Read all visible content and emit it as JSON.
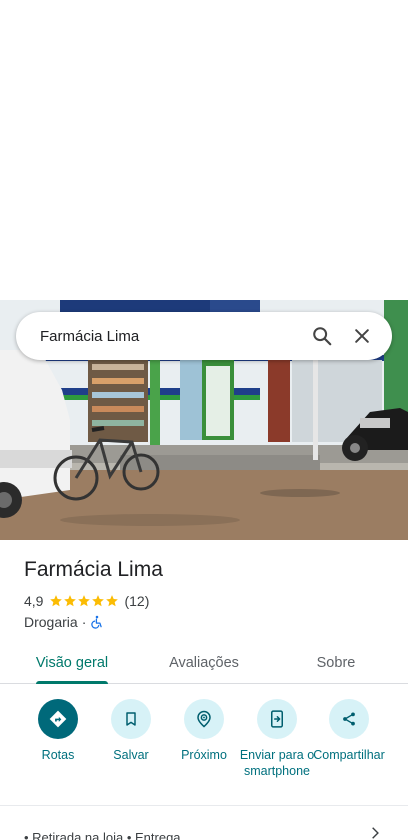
{
  "search": {
    "query": "Farmácia Lima",
    "search_icon": "search-icon",
    "close_icon": "close-icon"
  },
  "photo": {
    "icon": "storefront-photo"
  },
  "place": {
    "name": "Farmácia Lima",
    "rating": "4,9",
    "stars": 5,
    "review_count": "(12)",
    "category": "Drogaria",
    "separator": "·",
    "accessibility_icon": "wheelchair-icon"
  },
  "tabs": [
    {
      "label": "Visão geral",
      "active": true
    },
    {
      "label": "Avaliações",
      "active": false
    },
    {
      "label": "Sobre",
      "active": false
    }
  ],
  "actions": [
    {
      "label": "Rotas",
      "icon": "directions-icon"
    },
    {
      "label": "Salvar",
      "icon": "bookmark-icon"
    },
    {
      "label": "Próximo",
      "icon": "nearby-icon"
    },
    {
      "label": "Enviar para o smartphone",
      "icon": "send-to-phone-icon"
    },
    {
      "label": "Compartilhar",
      "icon": "share-icon"
    }
  ],
  "bottom": {
    "text": "• Retirada na loja  • Entrega",
    "chevron_icon": "chevron-right-icon"
  },
  "colors": {
    "accent": "#00796b",
    "action_bg": "#d7f2f7",
    "primary_action_bg": "#00697a",
    "star": "#fbbc04"
  }
}
